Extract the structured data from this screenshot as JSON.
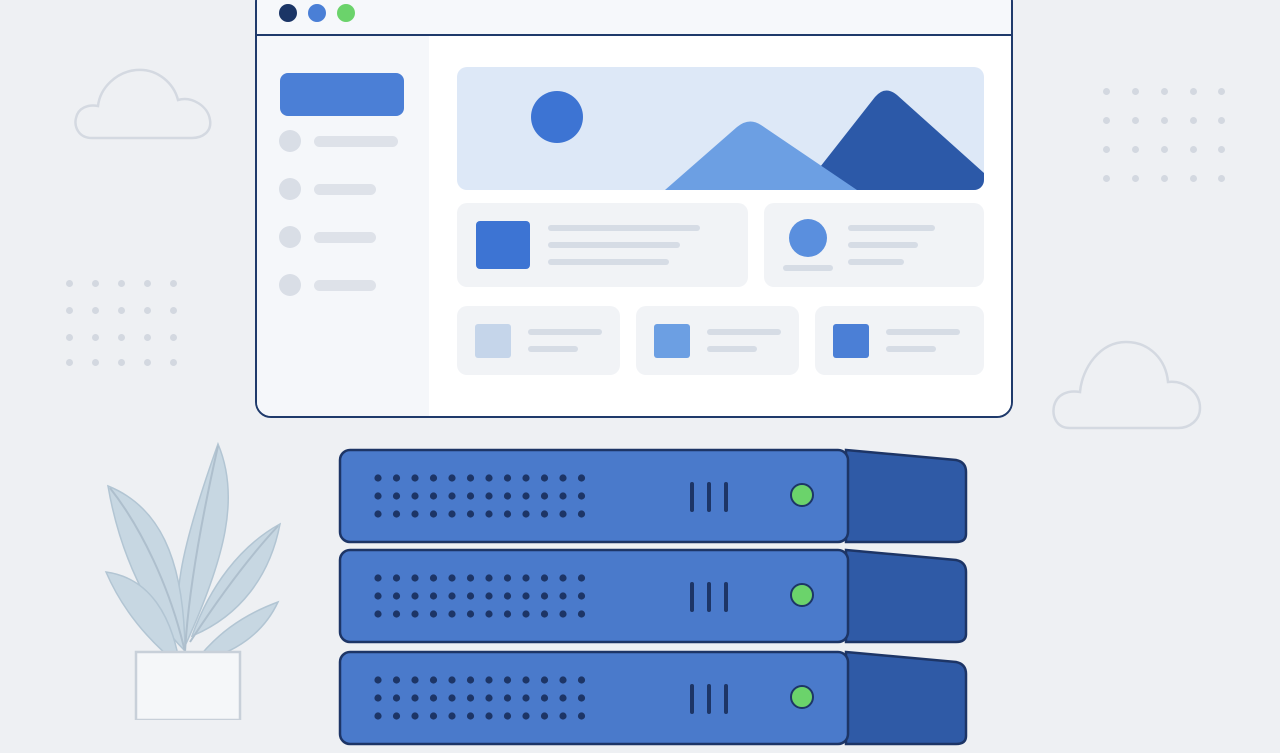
{
  "colors": {
    "background": "#eef0f3",
    "window_border": "#1f3a6b",
    "accent": "#4b7fd6",
    "accent_dark": "#2c59a8",
    "status_led": "#6bd36b",
    "server_front": "#4a7acb",
    "server_side": "#2f5aa6"
  },
  "window": {
    "controls": [
      "close-dot",
      "minimize-dot",
      "maximize-dot"
    ]
  },
  "sidebar": {
    "item_count": 4
  },
  "servers": {
    "unit_count": 3,
    "status": [
      "on",
      "on",
      "on"
    ]
  },
  "icons": [
    "cloud-icon",
    "plant-icon",
    "image-placeholder-icon",
    "mountain-icon",
    "sun-icon"
  ]
}
